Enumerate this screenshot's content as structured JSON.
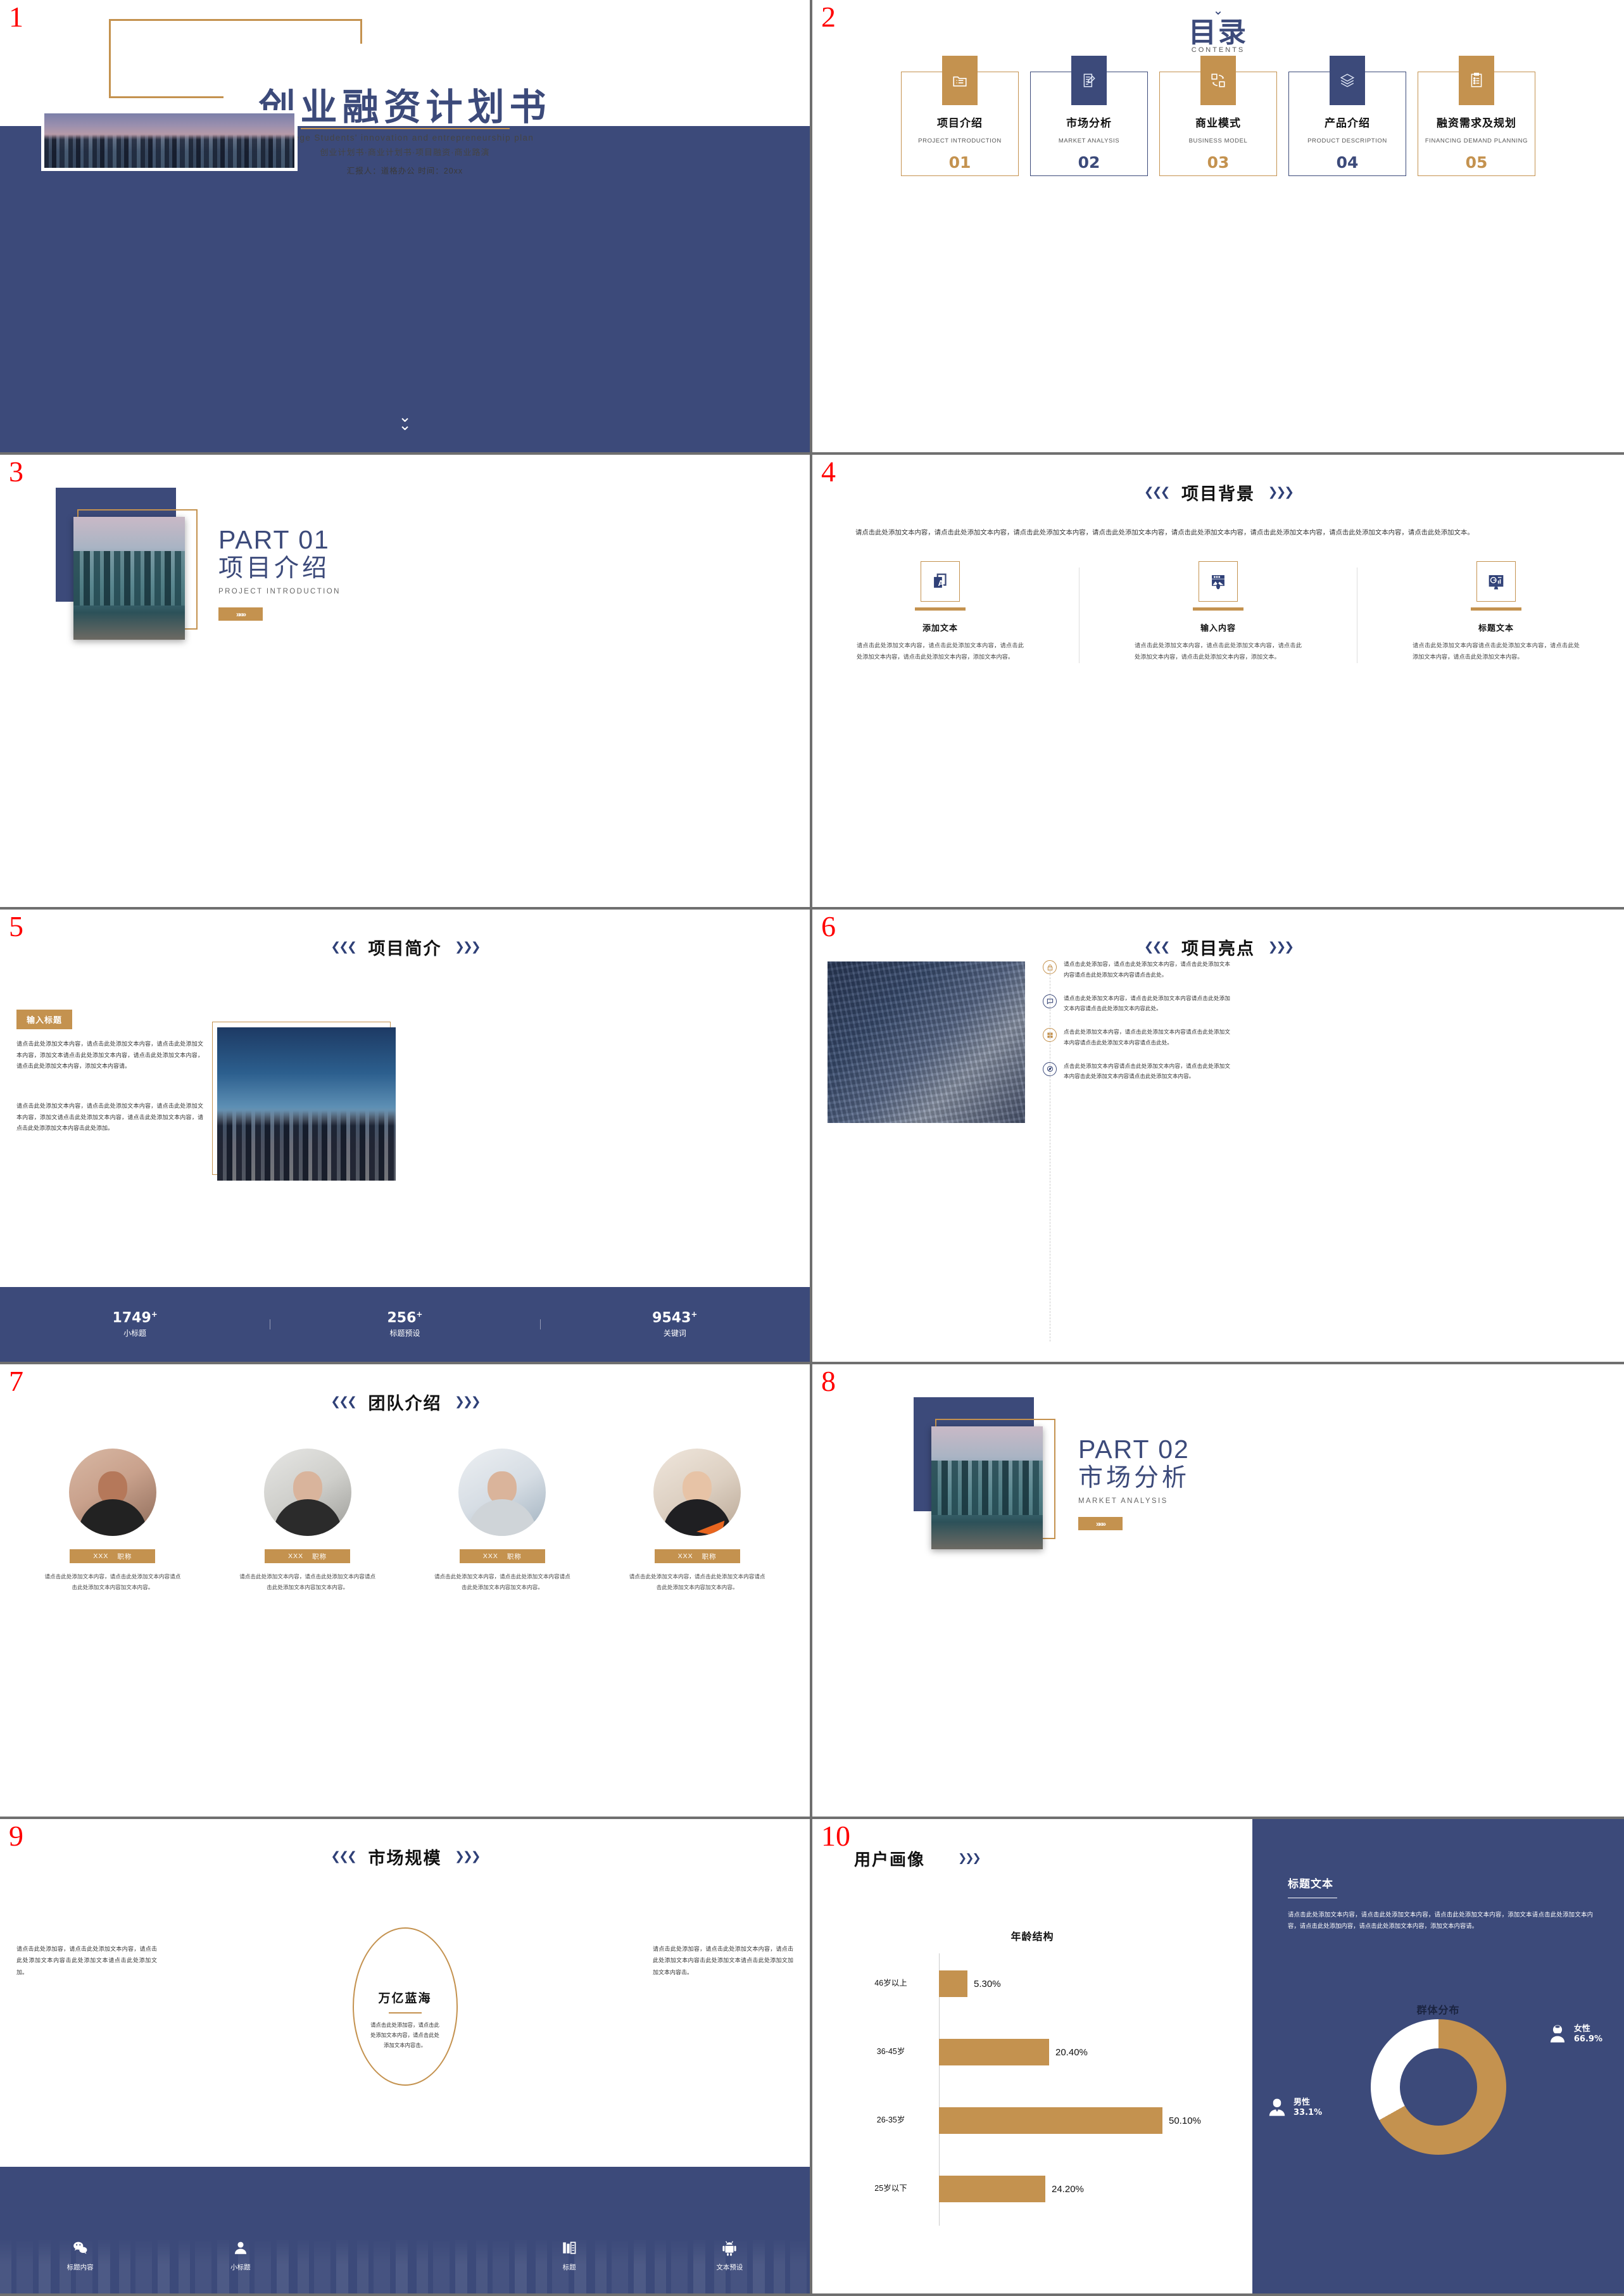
{
  "deck": {
    "accent_gold": "#c4924f",
    "accent_navy": "#3c4a7a",
    "slide_numbers": [
      "1",
      "2",
      "3",
      "4",
      "5",
      "6",
      "7",
      "8",
      "9",
      "10"
    ]
  },
  "slide1": {
    "title": "创业融资计划书",
    "subtitle_en": "College Students' innovation and entrepreneurship plan",
    "subtitle_cn": "创业计划书·商业计划书·项目融资·商业路演",
    "meta": "汇报人：道格办公    时间：20xx",
    "photo": "city-skyline-photo",
    "arrow": "chevron-double-down-icon"
  },
  "slide2": {
    "top_chevron": "chevron-double-down-icon",
    "title_cn": "目录",
    "title_en": "CONTENTS",
    "cards": [
      {
        "cn": "项目介绍",
        "en": "PROJECT INTRODUCTION",
        "no": "01",
        "color": "gold",
        "icon": "folder-list-icon"
      },
      {
        "cn": "市场分析",
        "en": "MARKET ANALYSIS",
        "no": "02",
        "color": "navy",
        "icon": "document-pencil-icon"
      },
      {
        "cn": "商业模式",
        "en": "BUSINESS MODEL",
        "no": "03",
        "color": "gold",
        "icon": "swap-squares-icon"
      },
      {
        "cn": "产品介绍",
        "en": "PRODUCT DESCRIPTION",
        "no": "04",
        "color": "navy",
        "icon": "layers-icon"
      },
      {
        "cn": "融资需求及规划",
        "en": "FINANCING DEMAND PLANNING",
        "no": "05",
        "color": "gold",
        "icon": "clipboard-list-icon"
      }
    ]
  },
  "slide3": {
    "part": "PART 01",
    "title_cn": "项目介绍",
    "title_en": "PROJECT INTRODUCTION",
    "button": "»»»",
    "photo": "waterfront-city-photo"
  },
  "slide4": {
    "title": "项目背景",
    "lead": "请点击此处添加文本内容，请点击此处添加文本内容，请点击此处添加文本内容，请点击此处添加文本内容，请点击此处添加文本内容，请点击此处添加文本内容，请点击此处添加文本内容，请点击此处添加文本。",
    "columns": [
      {
        "icon": "translate-icon",
        "heading": "添加文本",
        "text": "请点击此处添加文本内容，请点击此处添加文本内容，请点击此处添加文本内容，请点击此处添加文本内容，添加文本内容。"
      },
      {
        "icon": "mountain-photo-icon",
        "heading": "输入内容",
        "text": "请点击此处添加文本内容，请点击此处添加文本内容，请点击此处添加文本内容，请点击此处添加文本内容，添加文本。"
      },
      {
        "icon": "dashboard-chart-icon",
        "heading": "标题文本",
        "text": "请点击此处添加文本内容请点击此处添加文本内容，请点击此处添加文本内容，请点击此处添加文本内容。"
      }
    ]
  },
  "slide5": {
    "title": "项目简介",
    "tag": "输入标题",
    "para1": "请点击此处添加文本内容，请点击此处添加文本内容，请点击此处添加文本内容，添加文本请点击此处添加文本内容，请点击此处添加文本内容，请点击此处添加文本内容，添加文本内容请。",
    "para2": "请点击此处添加文本内容，请点击此处添加文本内容，请点击此处添加文本内容，添加文请点击此处添加文本内容，请点击此处添加文本内容，请点击此处添添加文本内容击此处添加。",
    "photo": "sunset-city-photo",
    "stats": [
      {
        "value": "1749",
        "plus": "+",
        "label": "小标题"
      },
      {
        "value": "256",
        "plus": "+",
        "label": "标题预设"
      },
      {
        "value": "9543",
        "plus": "+",
        "label": "关键词"
      }
    ]
  },
  "slide6": {
    "title": "项目亮点",
    "photo": "glass-skyscraper-photo",
    "items": [
      {
        "icon": "lock-icon",
        "color": "gold",
        "text": "请点击此处添加容，请点击此处添加文本内容，请点击此处添加文本内容请点击此处添加文本内容请点击此处。"
      },
      {
        "icon": "chat-icon",
        "color": "navy",
        "text": "请点击此处添加文本内容，请点击此处添加文本内容请点击此处添加文本内容请点击此处添加文本内容此处。"
      },
      {
        "icon": "grid-icon",
        "color": "gold",
        "text": "点击此处添加文本内容，请点击此处添加文本内容请点击此处添加文本内容请点击此处添加文本内容请点击此处。"
      },
      {
        "icon": "compass-icon",
        "color": "navy",
        "text": "点击此处添加文本内容请点击此处添加文本内容，请点击此处添加文本内容击此处添加文本内容请点击此处添加文本内容。"
      }
    ]
  },
  "slide7": {
    "title": "团队介绍",
    "members": [
      {
        "name": "XXX",
        "role": "职称",
        "desc": "请点击此处添加文本内容，请点击此处添加文本内容请点击此处添加文本内容加文本内容。",
        "avatar": "team-member-photo-1"
      },
      {
        "name": "XXX",
        "role": "职称",
        "desc": "请点击此处添加文本内容，请点击此处添加文本内容请点击此处添加文本内容加文本内容。",
        "avatar": "team-member-photo-2"
      },
      {
        "name": "XXX",
        "role": "职称",
        "desc": "请点击此处添加文本内容，请点击此处添加文本内容请点击此处添加文本内容加文本内容。",
        "avatar": "team-member-photo-3"
      },
      {
        "name": "XXX",
        "role": "职称",
        "desc": "请点击此处添加文本内容，请点击此处添加文本内容请点击此处添加文本内容加文本内容。",
        "avatar": "team-member-photo-4"
      }
    ]
  },
  "slide8": {
    "part": "PART 02",
    "title_cn": "市场分析",
    "title_en": "MARKET ANALYSIS",
    "button": "»»»",
    "photo": "waterfront-city-photo"
  },
  "slide9": {
    "title": "市场规模",
    "left_text": "请点击此处添加容，请点击此处添加文本内容，请点击此处添加文本内容击此处添加文本请点击此处添加文加。",
    "right_text": "请点击此处添加容，请点击此处添加文本内容，请点击此处添加文本内容击此处添加文本请点击此处添加文加加文本内容击。",
    "oval_title": "万亿蓝海",
    "oval_text": "请点击此处添加容，请点击此处添加文本内容，请点击此处添加文本内容击。",
    "icons": [
      {
        "icon": "wechat-icon",
        "label": "标题内容"
      },
      {
        "icon": "user-icon",
        "label": "小标题"
      },
      {
        "icon": "books-icon",
        "label": "标题"
      },
      {
        "icon": "android-icon",
        "label": "文本预设"
      }
    ]
  },
  "slide10": {
    "title": "用户画像",
    "title_chevron": "chevron-right-triple-icon",
    "right_heading": "标题文本",
    "right_text": "请点击此处添加文本内容，请点击此处添加文本内容，请点击此处添加文本内容，添加文本请点击此处添加文本内容，请点击此处添加内容，请点击此处添加文本内容，添加文本内容请。",
    "legend": [
      {
        "icon": "female-icon",
        "label": "女性",
        "value": "66.9%"
      },
      {
        "icon": "male-icon",
        "label": "男性",
        "value": "33.1%"
      }
    ],
    "chart_data": [
      {
        "type": "bar",
        "orientation": "horizontal",
        "title": "年龄结构",
        "categories": [
          "46岁以上",
          "36-45岁",
          "26-35岁",
          "25岁以下"
        ],
        "values": [
          5.3,
          20.4,
          50.1,
          24.2
        ],
        "value_labels": [
          "5.30%",
          "20.40%",
          "50.10%",
          "24.20%"
        ],
        "xlabel": "",
        "ylabel": "",
        "xlim": [
          0,
          55
        ],
        "grid": false,
        "legend": "none",
        "series_color": "#c4924f"
      },
      {
        "type": "pie",
        "subtype": "donut",
        "title": "群体分布",
        "categories": [
          "女性",
          "男性"
        ],
        "values": [
          66.9,
          33.1
        ],
        "value_labels": [
          "66.9%",
          "33.1%"
        ],
        "colors": [
          "#c4924f",
          "#ffffff"
        ],
        "legend": "sides"
      }
    ]
  }
}
